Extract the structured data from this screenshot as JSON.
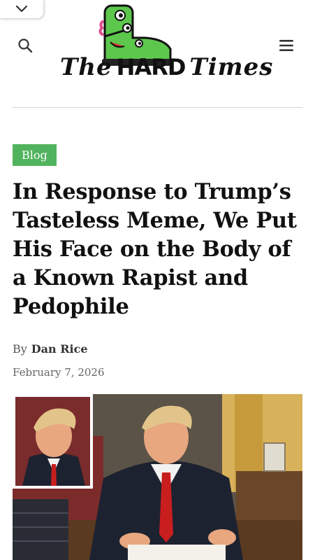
{
  "header": {
    "logo_prefix": "The",
    "logo_hard": "HARD",
    "logo_suffix": "Times",
    "icons": {
      "collapse": "chevron-down-icon",
      "search": "search-icon",
      "menu": "hamburger-menu-icon",
      "logo_mascot": "boot-monster-icon"
    }
  },
  "article": {
    "category": "Blog",
    "headline": "In Response to Trump’s Tasteless Meme, We Put His Face on the Body of a Known Rapist and Pedophile",
    "byline_prefix": "By",
    "author": "Dan Rice",
    "date": "February 7, 2026"
  },
  "colors": {
    "badge_green": "#51b35e",
    "mascot_green": "#5cc74c",
    "tie_red": "#c81e1e"
  }
}
